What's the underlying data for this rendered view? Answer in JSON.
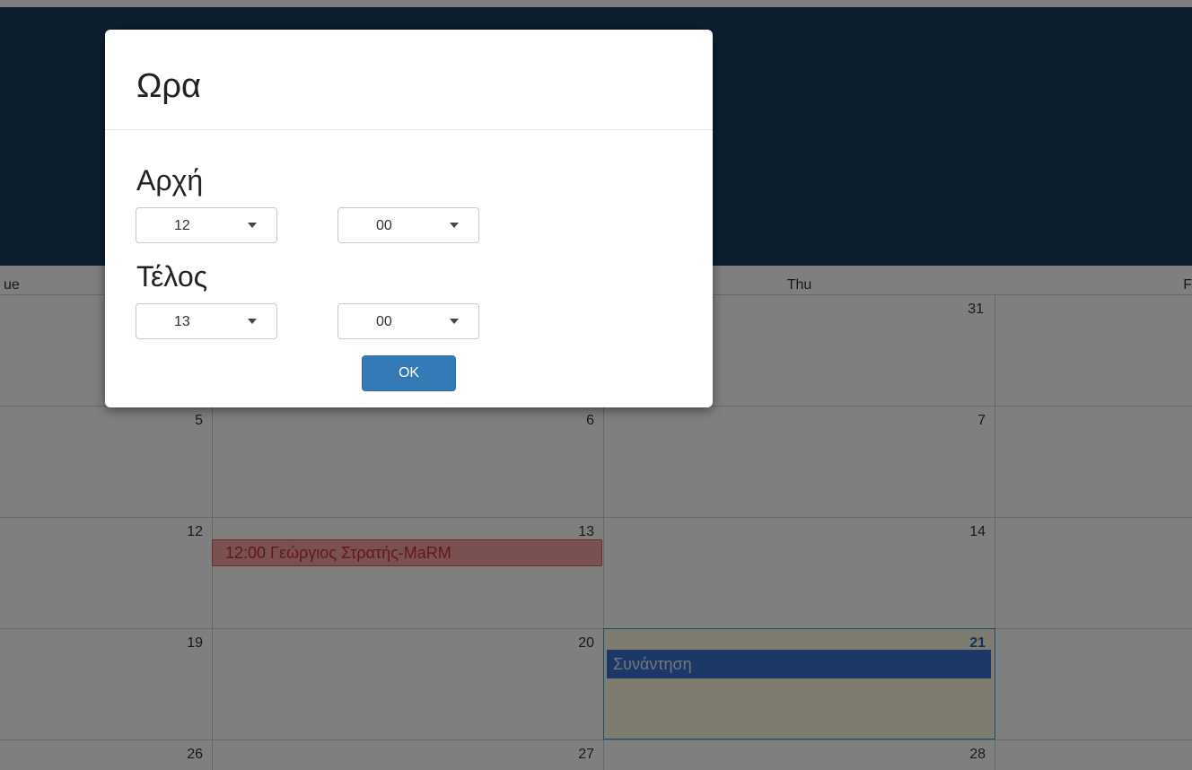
{
  "calendar": {
    "dow": {
      "tue": "ue",
      "thu": "Thu",
      "fri": "F"
    },
    "weeks": [
      [
        "",
        "",
        "31"
      ],
      [
        "5",
        "6",
        "7"
      ],
      [
        "12",
        "13",
        "14"
      ],
      [
        "19",
        "20",
        "21"
      ],
      [
        "26",
        "27",
        "28"
      ]
    ],
    "events": {
      "red": "12:00 Γεώργιος Στρατής-MaRM",
      "blue": "Συνάντηση"
    },
    "colors": {
      "header": "#1b3d5e",
      "today_border": "#2a9fd6",
      "event_red": "#d9534f",
      "event_blue": "#3a6fcf"
    }
  },
  "modal": {
    "title": "Ωρα",
    "start_label": "Αρχή",
    "start_hour": "12",
    "start_minute": "00",
    "end_label": "Τέλος",
    "end_hour": "13",
    "end_minute": "00",
    "ok_label": "OK"
  }
}
